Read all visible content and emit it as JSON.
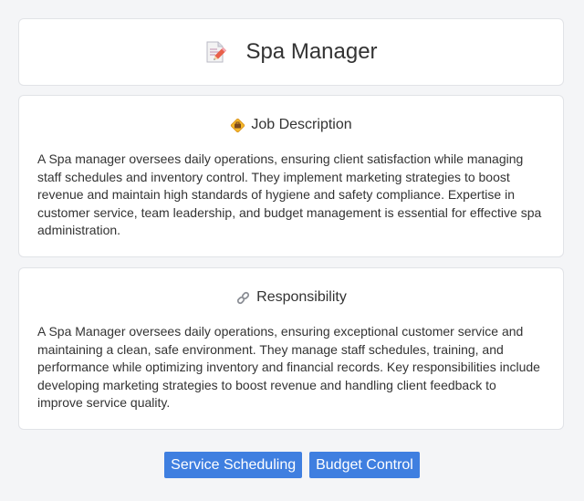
{
  "header": {
    "title": "Spa Manager",
    "icon": "memo-pencil-icon"
  },
  "job_description": {
    "icon": "job-badge-icon",
    "title": "Job Description",
    "text": "A Spa manager oversees daily operations, ensuring client satisfaction while managing staff schedules and inventory control. They implement marketing strategies to boost revenue and maintain high standards of hygiene and safety compliance. Expertise in customer service, team leadership, and budget management is essential for effective spa administration."
  },
  "responsibility": {
    "icon": "link-icon",
    "title": "Responsibility",
    "text": "A Spa Manager oversees daily operations, ensuring exceptional customer service and maintaining a clean, safe environment. They manage staff schedules, training, and performance while optimizing inventory and financial records. Key responsibilities include developing marketing strategies to boost revenue and handling client feedback to improve service quality."
  },
  "tags": [
    "Service Scheduling",
    "Budget Control"
  ],
  "colors": {
    "tag_bg": "#3f7fe0",
    "page_bg": "#f4f5f7"
  }
}
